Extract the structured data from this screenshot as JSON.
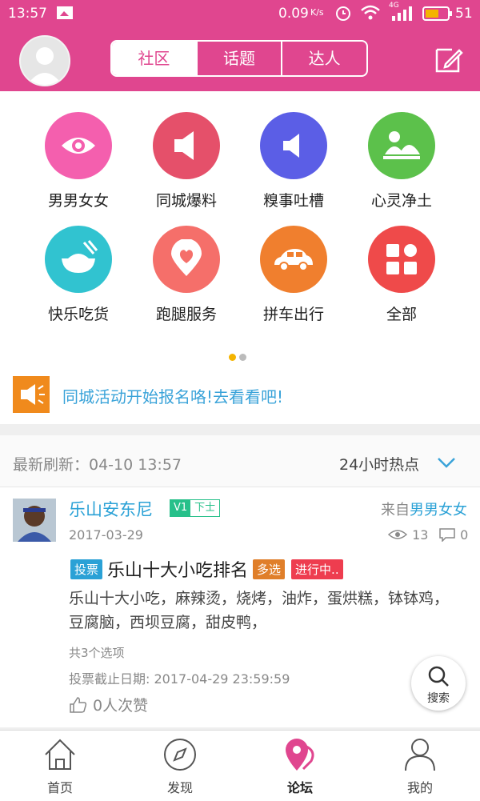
{
  "status_bar": {
    "time": "13:57",
    "net_speed": "0.09",
    "net_unit": "K/s",
    "net_type": "4G",
    "battery": "51"
  },
  "header": {
    "tabs": [
      "社区",
      "话题",
      "达人"
    ],
    "active_tab": "社区"
  },
  "categories": [
    {
      "label": "男男女女",
      "color": "#f45fae",
      "icon": "eye-icon"
    },
    {
      "label": "同城爆料",
      "color": "#e5506a",
      "icon": "speaker-icon"
    },
    {
      "label": "糗事吐槽",
      "color": "#5b5ee6",
      "icon": "speaker-icon"
    },
    {
      "label": "心灵净土",
      "color": "#5cc14b",
      "icon": "landscape-icon"
    },
    {
      "label": "快乐吃货",
      "color": "#31c3d0",
      "icon": "bowl-icon"
    },
    {
      "label": "跑腿服务",
      "color": "#f56f6a",
      "icon": "heart-pin-icon"
    },
    {
      "label": "拼车出行",
      "color": "#f07f2e",
      "icon": "car-icon"
    },
    {
      "label": "全部",
      "color": "#ef4a4a",
      "icon": "grid-icon"
    }
  ],
  "pager": {
    "active_color": "#f4b400",
    "inactive_color": "#bbbbbb"
  },
  "notice": {
    "text": "同城活动开始报名咯!去看看吧!"
  },
  "refresh": {
    "label": "最新刷新：04-10 13:57",
    "hot": "24小时热点"
  },
  "post": {
    "user": "乐山安东尼",
    "badge_level": "V1",
    "badge_rank": "下士",
    "from_prefix": "来自",
    "from_cat": "男男女女",
    "date": "2017-03-29",
    "views": "13",
    "comments": "0",
    "tag_vote": "投票",
    "title": "乐山十大小吃排名",
    "tag_multi": "多选",
    "tag_status": "进行中..",
    "body": "乐山十大小吃，麻辣烫，烧烤，油炸，蛋烘糕，钵钵鸡，豆腐脑，西坝豆腐，甜皮鸭，",
    "options": "共3个选项",
    "deadline": "投票截止日期: 2017-04-29 23:59:59",
    "likes": "0人次赞"
  },
  "search_fab": {
    "label": "搜索"
  },
  "tabbar": [
    {
      "label": "首页",
      "icon": "home-icon"
    },
    {
      "label": "发现",
      "icon": "compass-icon"
    },
    {
      "label": "论坛",
      "icon": "forum-pin-icon"
    },
    {
      "label": "我的",
      "icon": "person-icon"
    }
  ],
  "colors": {
    "brand": "#e0468f",
    "link": "#2aa1d6",
    "notice": "#f08a1c"
  }
}
